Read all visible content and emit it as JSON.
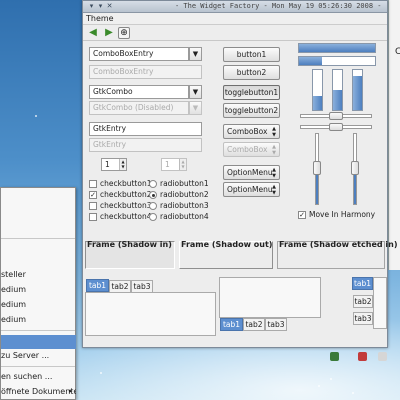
{
  "window": {
    "title": "- The Widget Factory - Mon May 19 05:26:30 2008 -",
    "menu": "Theme",
    "titlebar_buttons": [
      "▾",
      "▾",
      "✕"
    ],
    "tool_icons": {
      "back": "◀",
      "forward": "▶",
      "add": "⊕"
    }
  },
  "entries": {
    "combo_box_entry": "ComboBoxEntry",
    "combo_box_entry_disabled": "ComboBoxEntry",
    "gtk_combo": "GtkCombo",
    "gtk_combo_disabled": "GtkCombo (Disabled)",
    "gtk_entry": "GtkEntry",
    "gtk_entry_disabled": "GtkEntry"
  },
  "spinners": {
    "first": "1",
    "second": "1"
  },
  "checks": [
    {
      "label": "checkbutton1",
      "checked": ""
    },
    {
      "label": "checkbutton2",
      "checked": "✓"
    },
    {
      "label": "checkbutton3",
      "checked": ""
    },
    {
      "label": "checkbutton4",
      "checked": ""
    }
  ],
  "radios": [
    {
      "label": "radiobutton1",
      "selected": false
    },
    {
      "label": "radiobutton2",
      "selected": true
    },
    {
      "label": "radiobutton3",
      "selected": false
    },
    {
      "label": "radiobutton4",
      "selected": false
    }
  ],
  "buttons": {
    "button1": "button1",
    "button2": "button2",
    "toggle1": "togglebutton1",
    "toggle2": "togglebutton2",
    "combobox": "ComboBox",
    "combobox_disabled": "ComboBox",
    "option1": "OptionMenu",
    "option2": "OptionMenu"
  },
  "progress": {
    "horizontal_top": 1.0,
    "horizontal_bottom": 0.3,
    "vertical": [
      0.35,
      0.5,
      0.85
    ]
  },
  "move_in_harmony": {
    "label": "Move In Harmony",
    "checked": "✓"
  },
  "frames": {
    "shadow_in": "Frame (Shadow in)",
    "shadow_out": "Frame (Shadow out)",
    "shadow_etched_in": "Frame (Shadow etched in)"
  },
  "tabs": {
    "top": [
      "tab1",
      "tab2",
      "tab3"
    ],
    "bottom": [
      "tab1",
      "tab2",
      "tab3"
    ],
    "right": [
      "tab1",
      "tab2",
      "tab3"
    ]
  },
  "popup_menu": {
    "items": [
      {
        "label": "steller",
        "highlight": false
      },
      {
        "label": "edium",
        "highlight": false
      },
      {
        "label": "edium",
        "highlight": false
      },
      {
        "label": "edium",
        "highlight": false
      },
      {
        "label": "",
        "highlight": true
      },
      {
        "label": " zu Server ...",
        "highlight": false
      },
      {
        "label": "en suchen ...",
        "highlight": false
      },
      {
        "label": "öffnete Dokumente",
        "highlight": false
      }
    ],
    "submenu_arrow": "▸"
  },
  "colors": {
    "accent": "#5d8fd0",
    "window_bg": "#ededed",
    "desktop_top": "#2f6fae"
  }
}
